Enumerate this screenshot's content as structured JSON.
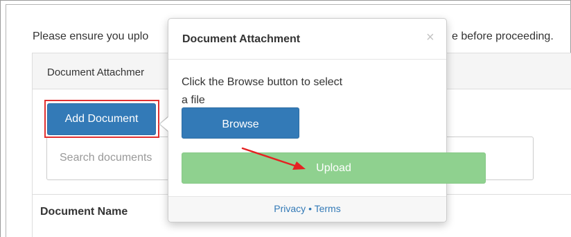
{
  "page": {
    "notice_prefix": "Please ensure you uplo",
    "notice_suffix": "e before proceeding."
  },
  "panel": {
    "heading": "Document Attachmer",
    "add_button_label": "Add Document",
    "search_placeholder": "Search documents",
    "column_header": "Document Name"
  },
  "popover": {
    "title": "Document Attachment",
    "close_symbol": "×",
    "instructions": "Click the Browse button to select a file",
    "browse_label": "Browse",
    "upload_label": "Upload",
    "footer_privacy": "Privacy",
    "footer_separator": "•",
    "footer_terms": "Terms"
  },
  "colors": {
    "primary_button": "#337ab7",
    "upload_button": "#8fd18f",
    "highlight": "#e03030",
    "annotation_arrow": "#e52222",
    "link": "#337ab7"
  }
}
